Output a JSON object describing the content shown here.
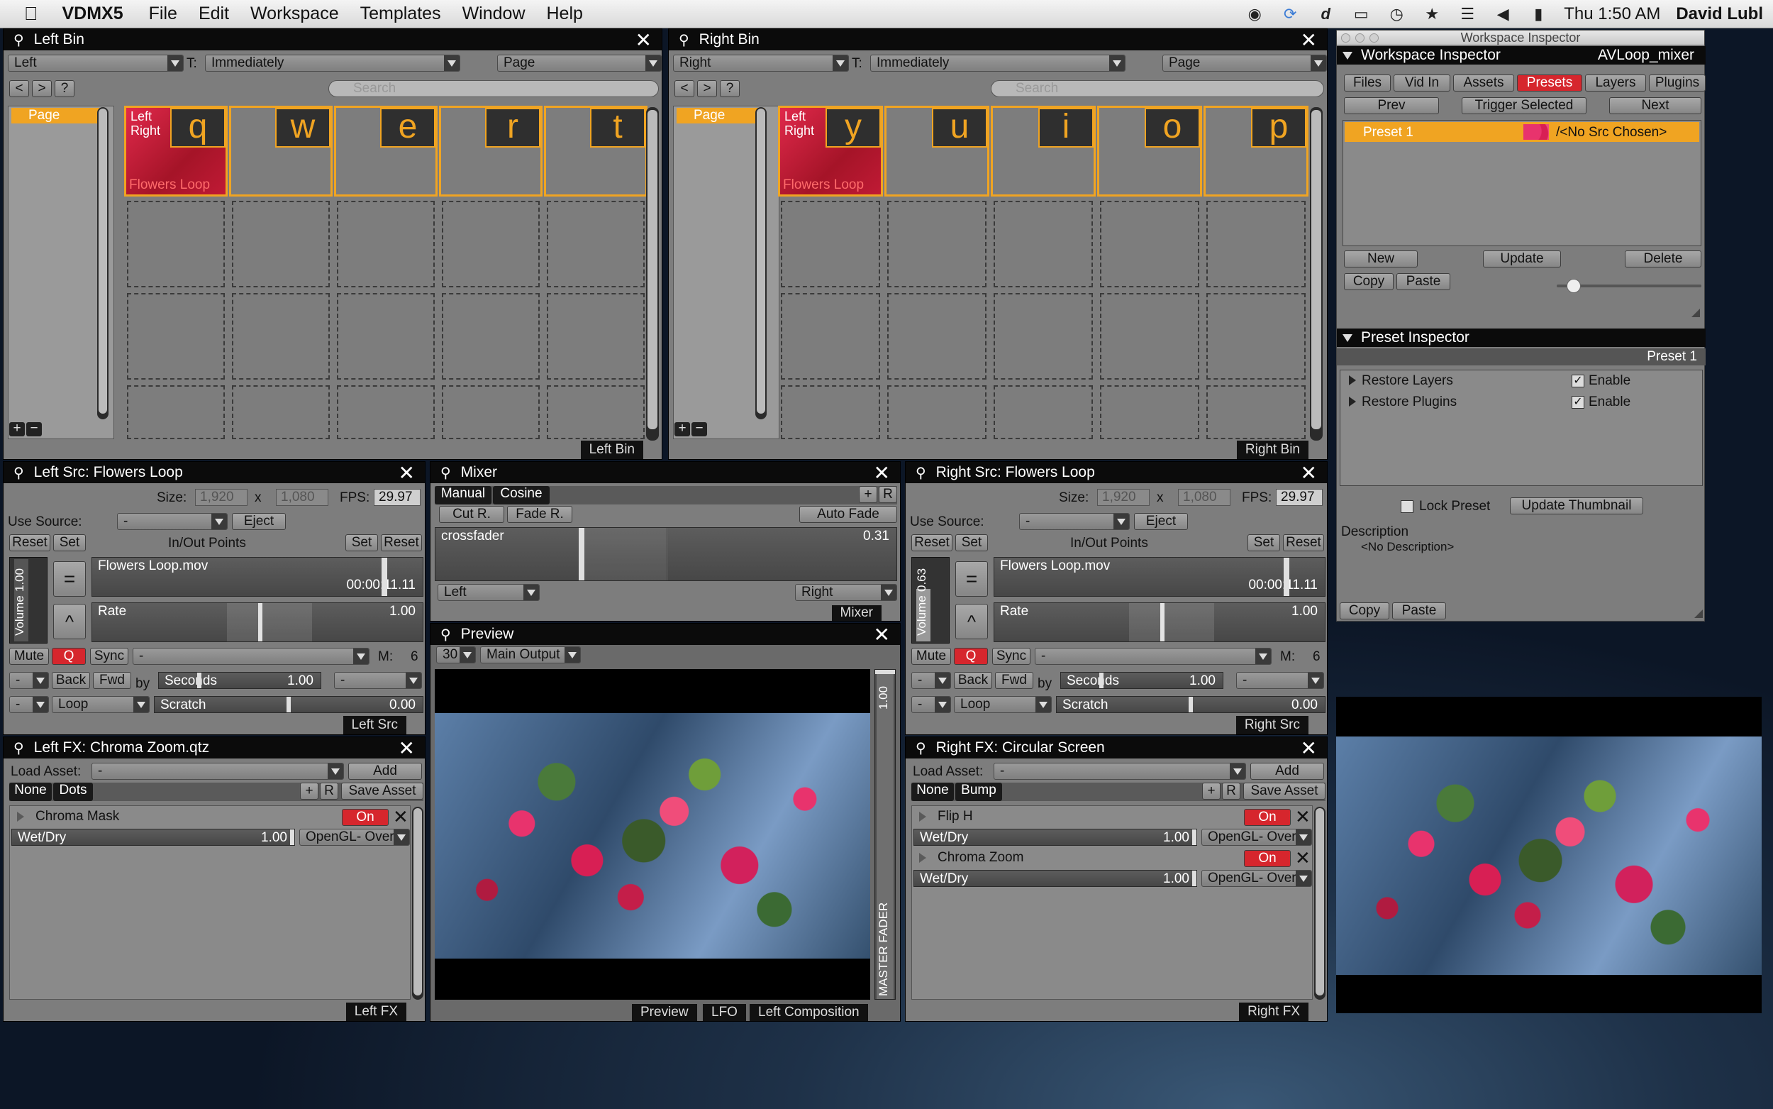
{
  "menubar": {
    "app": "VDMX5",
    "items": [
      "File",
      "Edit",
      "Workspace",
      "Templates",
      "Window",
      "Help"
    ],
    "clock": "Thu 1:50 AM",
    "user": "David Lubl"
  },
  "leftbin": {
    "title": "Left Bin",
    "dd1": "Left",
    "t_label": "T:",
    "dd2": "Immediately",
    "dd3": "Page",
    "search_placeholder": "Search",
    "nav": [
      "<",
      ">",
      "?"
    ],
    "page_item": "Page",
    "keys": [
      "q",
      "w",
      "e",
      "r",
      "t"
    ],
    "clip_line1": "Left",
    "clip_line2": "Right",
    "clip_name": "Flowers Loop",
    "footer": "Left Bin",
    "tree_buttons": [
      "+",
      "−"
    ]
  },
  "rightbin": {
    "title": "Right Bin",
    "dd1": "Right",
    "t_label": "T:",
    "dd2": "Immediately",
    "dd3": "Page",
    "search_placeholder": "Search",
    "nav": [
      "<",
      ">",
      "?"
    ],
    "page_item": "Page",
    "keys": [
      "y",
      "u",
      "i",
      "o",
      "p"
    ],
    "clip_line1": "Left",
    "clip_line2": "Right",
    "clip_name": "Flowers Loop",
    "footer": "Right Bin",
    "tree_buttons": [
      "+",
      "−"
    ]
  },
  "leftsrc": {
    "title": "Left Src: Flowers Loop",
    "size_label": "Size:",
    "w": "1,920",
    "x": "x",
    "h": "1,080",
    "fps_label": "FPS:",
    "fps": "29.97",
    "use_source": "Use Source:",
    "source_val": "-",
    "eject": "Eject",
    "inout": "In/Out Points",
    "reset": "Reset",
    "set": "Set",
    "file": "Flowers Loop.mov",
    "time": "00:00:11.11",
    "rate_label": "Rate",
    "rate": "1.00",
    "volume": "Volume",
    "volume_val": "1.00",
    "eq": "=",
    "up": "^",
    "mute": "Mute",
    "q": "Q",
    "sync": "Sync",
    "sync_val": "-",
    "m_label": "M:",
    "m_val": "6",
    "dash": "-",
    "back": "Back",
    "fwd": "Fwd",
    "by": "by",
    "seconds": "Seconds",
    "seconds_val": "1.00",
    "loop": "Loop",
    "scratch": "Scratch",
    "scratch_val": "0.00",
    "footer": "Left Src"
  },
  "rightsrc": {
    "title": "Right Src: Flowers Loop",
    "size_label": "Size:",
    "w": "1,920",
    "x": "x",
    "h": "1,080",
    "fps_label": "FPS:",
    "fps": "29.97",
    "use_source": "Use Source:",
    "source_val": "-",
    "eject": "Eject",
    "inout": "In/Out Points",
    "reset": "Reset",
    "set": "Set",
    "file": "Flowers Loop.mov",
    "time": "00:00:11.11",
    "rate_label": "Rate",
    "rate": "1.00",
    "volume": "Volume",
    "volume_val": "0.63",
    "eq": "=",
    "up": "^",
    "mute": "Mute",
    "q": "Q",
    "sync": "Sync",
    "sync_val": "-",
    "m_label": "M:",
    "m_val": "6",
    "dash": "-",
    "back": "Back",
    "fwd": "Fwd",
    "by": "by",
    "seconds": "Seconds",
    "seconds_val": "1.00",
    "loop": "Loop",
    "scratch": "Scratch",
    "scratch_val": "0.00",
    "footer": "Right Src"
  },
  "mixer": {
    "title": "Mixer",
    "manual": "Manual",
    "cosine": "Cosine",
    "plus": "+",
    "r": "R",
    "cutr": "Cut R.",
    "fader": "Fade R.",
    "autofade": "Auto Fade",
    "crossfader": "crossfader",
    "cross_val": "0.31",
    "left": "Left",
    "right": "Right",
    "footer": "Mixer"
  },
  "preview": {
    "title": "Preview",
    "fps": "30",
    "output": "Main Output",
    "master": "MASTER FADER",
    "master_val": "1.00",
    "tabs": [
      "Preview",
      "LFO",
      "Left Composition"
    ]
  },
  "leftfx": {
    "title": "Left FX: Chroma Zoom.qtz",
    "load_asset": "Load Asset:",
    "asset_val": "-",
    "add": "Add",
    "none": "None",
    "tab2": "Dots",
    "plus": "+",
    "r": "R",
    "save": "Save Asset",
    "fx": [
      {
        "name": "Chroma Mask",
        "on": "On",
        "wet": "Wet/Dry",
        "val": "1.00",
        "blend": "OpenGL- Over"
      }
    ],
    "footer": "Left FX"
  },
  "rightfx": {
    "title": "Right FX: Circular Screen",
    "load_asset": "Load Asset:",
    "asset_val": "-",
    "add": "Add",
    "none": "None",
    "tab2": "Bump",
    "plus": "+",
    "r": "R",
    "save": "Save Asset",
    "fx": [
      {
        "name": "Flip H",
        "on": "On",
        "wet": "Wet/Dry",
        "val": "1.00",
        "blend": "OpenGL- Over"
      },
      {
        "name": "Chroma Zoom",
        "on": "On",
        "wet": "Wet/Dry",
        "val": "1.00",
        "blend": "OpenGL- Over"
      }
    ],
    "footer": "Right FX"
  },
  "inspector": {
    "window_title": "Workspace Inspector",
    "header": "Workspace Inspector",
    "layout": "AVLoop_mixer",
    "tabs": [
      "Files",
      "Vid In",
      "Assets",
      "Presets",
      "Layers",
      "Plugins"
    ],
    "prev": "Prev",
    "trigger": "Trigger Selected",
    "next": "Next",
    "preset_name": "Preset 1",
    "preset_src": "/<No Src Chosen>",
    "new": "New",
    "update": "Update",
    "delete": "Delete",
    "copy": "Copy",
    "paste": "Paste",
    "pi_header": "Preset Inspector",
    "pi_current": "Preset 1",
    "restore_layers": "Restore Layers",
    "restore_plugins": "Restore Plugins",
    "enable": "Enable",
    "lock": "Lock Preset",
    "update_thumb": "Update Thumbnail",
    "desc_label": "Description",
    "desc": "<No Description>"
  }
}
